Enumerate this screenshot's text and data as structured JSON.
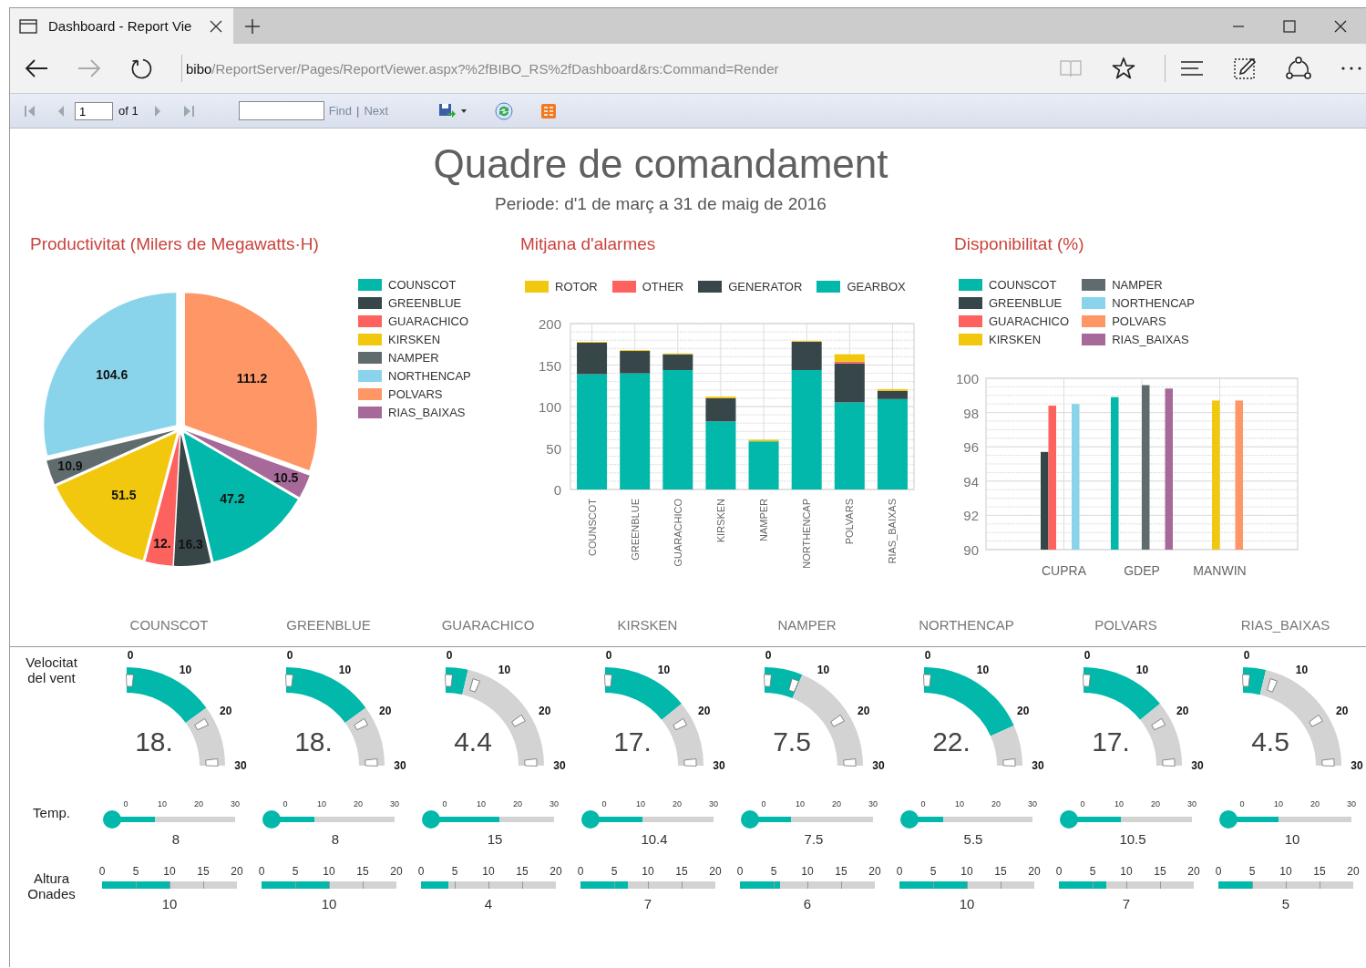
{
  "browser": {
    "tab_title": "Dashboard - Report Vie",
    "url_host": "bibo",
    "url_path": "/ReportServer/Pages/ReportViewer.aspx?%2fBIBO_RS%2fDashboard&rs:Command=Render"
  },
  "report_toolbar": {
    "page": "1",
    "page_count": "of 1",
    "find_label": "Find",
    "separator": "|",
    "next_label": "Next"
  },
  "report": {
    "title": "Quadre de comandament",
    "subtitle": "Periode: d'1 de març a 31 de maig de 2016"
  },
  "productivity": {
    "title": "Productivitat (Milers de Megawatts·H)",
    "chart_data": {
      "type": "pie",
      "categories": [
        "COUNSCOT",
        "GREENBLUE",
        "GUARACHICO",
        "KIRSKEN",
        "NAMPER",
        "NORTHENCAP",
        "POLVARS",
        "RIAS_BAIXAS"
      ],
      "colors": [
        "#01b8aa",
        "#374649",
        "#fd625e",
        "#f2c80f",
        "#5f6b6d",
        "#8ad4eb",
        "#fe9666",
        "#a66999"
      ],
      "values": [
        47.2,
        16.3,
        12.1,
        51.5,
        10.9,
        104.6,
        111.2,
        10.5
      ],
      "value_labels": [
        "47.2",
        "16.3",
        "12.",
        "51.5",
        "10.9",
        "104.6",
        "111.2",
        "10.5"
      ]
    }
  },
  "alarms": {
    "title": "Mitjana d'alarmes",
    "chart_data": {
      "type": "bar",
      "stacked": true,
      "grid": true,
      "categories": [
        "COUNSCOT",
        "GREENBLUE",
        "GUARACHICO",
        "KIRSKEN",
        "NAMPER",
        "NORTHENCAP",
        "POLVARS",
        "RIAS_BAIXAS"
      ],
      "series": [
        {
          "name": "GEARBOX",
          "color": "#01b8aa",
          "values": [
            139,
            140,
            144,
            82,
            58,
            144,
            105,
            109
          ]
        },
        {
          "name": "GENERATOR",
          "color": "#374649",
          "values": [
            38,
            27,
            19,
            28,
            0,
            34,
            47,
            10
          ]
        },
        {
          "name": "OTHER",
          "color": "#fd625e",
          "values": [
            0,
            0,
            0,
            0,
            0,
            0,
            2,
            0
          ]
        },
        {
          "name": "ROTOR",
          "color": "#f2c80f",
          "values": [
            1,
            1,
            1,
            2,
            2,
            1,
            9,
            2
          ]
        }
      ],
      "ylim": [
        0,
        200
      ],
      "yticks": [
        0,
        50,
        100,
        150,
        200
      ]
    }
  },
  "availability": {
    "title": "Disponibilitat (%)",
    "chart_data": {
      "type": "bar",
      "stacked": false,
      "grid": true,
      "categories": [
        "CUPRA",
        "GDEP",
        "MANWIN"
      ],
      "series": [
        {
          "name": "COUNSCOT",
          "color": "#01b8aa",
          "values": [
            null,
            98.9,
            null
          ]
        },
        {
          "name": "GREENBLUE",
          "color": "#374649",
          "values": [
            95.7,
            null,
            null
          ]
        },
        {
          "name": "GUARACHICO",
          "color": "#fd625e",
          "values": [
            98.4,
            null,
            null
          ]
        },
        {
          "name": "KIRSKEN",
          "color": "#f2c80f",
          "values": [
            null,
            null,
            98.7
          ]
        },
        {
          "name": "NAMPER",
          "color": "#5f6b6d",
          "values": [
            null,
            99.6,
            null
          ]
        },
        {
          "name": "NORTHENCAP",
          "color": "#8ad4eb",
          "values": [
            98.5,
            null,
            null
          ]
        },
        {
          "name": "POLVARS",
          "color": "#fe9666",
          "values": [
            null,
            null,
            98.7
          ]
        },
        {
          "name": "RIAS_BAIXAS",
          "color": "#a66999",
          "values": [
            null,
            99.4,
            null
          ]
        }
      ],
      "ylim": [
        90,
        100
      ],
      "yticks": [
        90,
        92,
        94,
        96,
        98,
        100
      ]
    }
  },
  "stations": {
    "row_labels": {
      "wind": "Velocitat del vent",
      "temp": "Temp.",
      "waves": "Altura Onades"
    },
    "items": [
      {
        "name": "COUNSCOT",
        "wind": {
          "reading": "18.",
          "ticks": [
            "0",
            "10",
            "20",
            "30"
          ]
        },
        "temp": {
          "reading": "8",
          "level": 0.27,
          "ticks": [
            "0",
            "10",
            "20",
            "30"
          ]
        },
        "waves": {
          "reading": "10",
          "level": 0.5,
          "ticks": [
            "0",
            "5",
            "10",
            "15",
            "20"
          ]
        }
      },
      {
        "name": "GREENBLUE",
        "wind": {
          "reading": "18.",
          "ticks": [
            "0",
            "10",
            "20",
            "30"
          ]
        },
        "temp": {
          "reading": "8",
          "level": 0.27,
          "ticks": [
            "0",
            "10",
            "20",
            "30"
          ]
        },
        "waves": {
          "reading": "10",
          "level": 0.5,
          "ticks": [
            "0",
            "5",
            "10",
            "15",
            "20"
          ]
        }
      },
      {
        "name": "GUARACHICO",
        "wind": {
          "reading": "4.4",
          "ticks": [
            "0",
            "10",
            "20",
            "30"
          ]
        },
        "temp": {
          "reading": "15",
          "level": 0.5,
          "ticks": [
            "0",
            "10",
            "20",
            "30"
          ]
        },
        "waves": {
          "reading": "4",
          "level": 0.2,
          "ticks": [
            "0",
            "5",
            "10",
            "15",
            "20"
          ]
        }
      },
      {
        "name": "KIRSKEN",
        "wind": {
          "reading": "17.",
          "ticks": [
            "0",
            "10",
            "20",
            "30"
          ]
        },
        "temp": {
          "reading": "10.4",
          "level": 0.35,
          "ticks": [
            "0",
            "10",
            "20",
            "30"
          ]
        },
        "waves": {
          "reading": "7",
          "level": 0.35,
          "ticks": [
            "0",
            "5",
            "10",
            "15",
            "20"
          ]
        }
      },
      {
        "name": "NAMPER",
        "wind": {
          "reading": "7.5",
          "ticks": [
            "0",
            "10",
            "20",
            "30"
          ]
        },
        "temp": {
          "reading": "7.5",
          "level": 0.25,
          "ticks": [
            "0",
            "10",
            "20",
            "30"
          ]
        },
        "waves": {
          "reading": "6",
          "level": 0.3,
          "ticks": [
            "0",
            "5",
            "10",
            "15",
            "20"
          ]
        }
      },
      {
        "name": "NORTHENCAP",
        "wind": {
          "reading": "22.",
          "ticks": [
            "0",
            "10",
            "20",
            "30"
          ]
        },
        "temp": {
          "reading": "5.5",
          "level": 0.18,
          "ticks": [
            "0",
            "10",
            "20",
            "30"
          ]
        },
        "waves": {
          "reading": "10",
          "level": 0.5,
          "ticks": [
            "0",
            "5",
            "10",
            "15",
            "20"
          ]
        }
      },
      {
        "name": "POLVARS",
        "wind": {
          "reading": "17.",
          "ticks": [
            "0",
            "10",
            "20",
            "30"
          ]
        },
        "temp": {
          "reading": "10.5",
          "level": 0.35,
          "ticks": [
            "0",
            "10",
            "20",
            "30"
          ]
        },
        "waves": {
          "reading": "7",
          "level": 0.35,
          "ticks": [
            "0",
            "5",
            "10",
            "15",
            "20"
          ]
        }
      },
      {
        "name": "RIAS_BAIXAS",
        "wind": {
          "reading": "4.5",
          "ticks": [
            "0",
            "10",
            "20",
            "30"
          ]
        },
        "temp": {
          "reading": "10",
          "level": 0.33,
          "ticks": [
            "0",
            "10",
            "20",
            "30"
          ]
        },
        "waves": {
          "reading": "5",
          "level": 0.25,
          "ticks": [
            "0",
            "5",
            "10",
            "15",
            "20"
          ]
        }
      }
    ]
  }
}
